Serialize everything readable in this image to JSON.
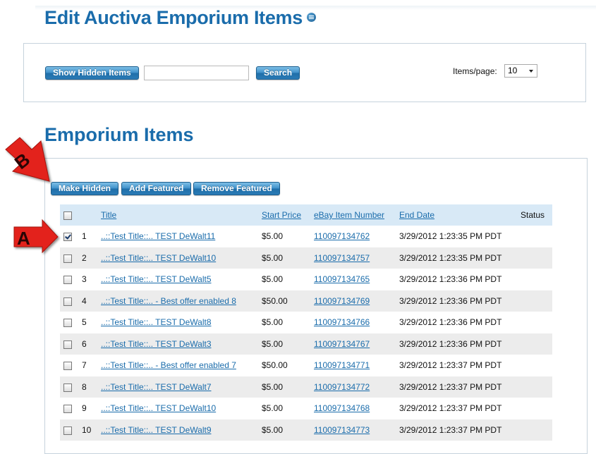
{
  "page": {
    "title": "Edit Auctiva Emporium Items",
    "help_icon": "help-icon"
  },
  "search": {
    "show_hidden_label": "Show Hidden Items",
    "search_value": "",
    "search_label": "Search",
    "per_page_label": "Items/page:",
    "per_page_value": "10"
  },
  "items": {
    "title": "Emporium Items",
    "actions": {
      "make_hidden": "Make Hidden",
      "add_featured": "Add Featured",
      "remove_featured": "Remove Featured"
    },
    "columns": {
      "title": "Title",
      "start_price": "Start Price",
      "item_number": "eBay Item Number",
      "end_date": "End Date",
      "status": "Status"
    },
    "rows": [
      {
        "num": "1",
        "title": "..::Test Title::.. TEST DeWalt11",
        "price": "$5.00",
        "item": "110097134762",
        "end": "3/29/2012 1:23:35 PM PDT",
        "checked": true
      },
      {
        "num": "2",
        "title": "..::Test Title::.. TEST DeWalt10",
        "price": "$5.00",
        "item": "110097134757",
        "end": "3/29/2012 1:23:35 PM PDT",
        "checked": false
      },
      {
        "num": "3",
        "title": "..::Test Title::.. TEST DeWalt5",
        "price": "$5.00",
        "item": "110097134765",
        "end": "3/29/2012 1:23:36 PM PDT",
        "checked": false
      },
      {
        "num": "4",
        "title": "..::Test Title::.. - Best offer enabled 8",
        "price": "$50.00",
        "item": "110097134769",
        "end": "3/29/2012 1:23:36 PM PDT",
        "checked": false
      },
      {
        "num": "5",
        "title": "..::Test Title::.. TEST DeWalt8",
        "price": "$5.00",
        "item": "110097134766",
        "end": "3/29/2012 1:23:36 PM PDT",
        "checked": false
      },
      {
        "num": "6",
        "title": "..::Test Title::.. TEST DeWalt3",
        "price": "$5.00",
        "item": "110097134767",
        "end": "3/29/2012 1:23:36 PM PDT",
        "checked": false
      },
      {
        "num": "7",
        "title": "..::Test Title::.. - Best offer enabled 7",
        "price": "$50.00",
        "item": "110097134771",
        "end": "3/29/2012 1:23:37 PM PDT",
        "checked": false
      },
      {
        "num": "8",
        "title": "..::Test Title::.. TEST DeWalt7",
        "price": "$5.00",
        "item": "110097134772",
        "end": "3/29/2012 1:23:37 PM PDT",
        "checked": false
      },
      {
        "num": "9",
        "title": "..::Test Title::.. TEST DeWalt10",
        "price": "$5.00",
        "item": "110097134768",
        "end": "3/29/2012 1:23:37 PM PDT",
        "checked": false
      },
      {
        "num": "10",
        "title": "..::Test Title::.. TEST DeWalt9",
        "price": "$5.00",
        "item": "110097134773",
        "end": "3/29/2012 1:23:37 PM PDT",
        "checked": false
      }
    ]
  },
  "annotations": {
    "a_label": "A",
    "b_label": "B",
    "color": "#e3201b"
  }
}
